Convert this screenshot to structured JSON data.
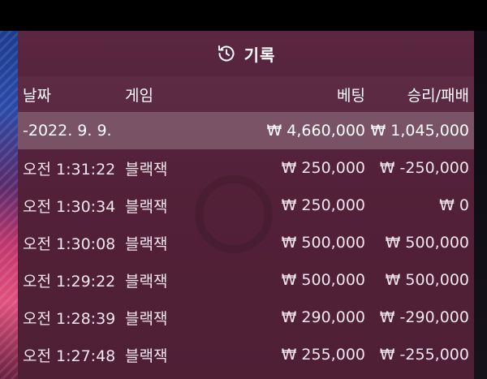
{
  "header": {
    "icon": "history-icon",
    "title": "기록"
  },
  "columns": {
    "date": "날짜",
    "game": "게임",
    "bet": "베팅",
    "result": "승리/패배"
  },
  "date_group": {
    "date": "-2022. 9. 9.",
    "bet_total": "₩ 4,660,000",
    "result_total": "₩ 1,045,000"
  },
  "rows": [
    {
      "time": "오전 1:31:22",
      "game": "블랙잭",
      "bet": "₩ 250,000",
      "result": "₩ -250,000"
    },
    {
      "time": "오전 1:30:34",
      "game": "블랙잭",
      "bet": "₩ 250,000",
      "result": "₩ 0"
    },
    {
      "time": "오전 1:30:08",
      "game": "블랙잭",
      "bet": "₩ 500,000",
      "result": "₩ 500,000"
    },
    {
      "time": "오전 1:29:22",
      "game": "블랙잭",
      "bet": "₩ 500,000",
      "result": "₩ 500,000"
    },
    {
      "time": "오전 1:28:39",
      "game": "블랙잭",
      "bet": "₩ 290,000",
      "result": "₩ -290,000"
    },
    {
      "time": "오전 1:27:48",
      "game": "블랙잭",
      "bet": "₩ 255,000",
      "result": "₩ -255,000"
    }
  ],
  "colors": {
    "panel": "#532139",
    "highlight_row": "#7a5566",
    "text": "#ffffff"
  }
}
